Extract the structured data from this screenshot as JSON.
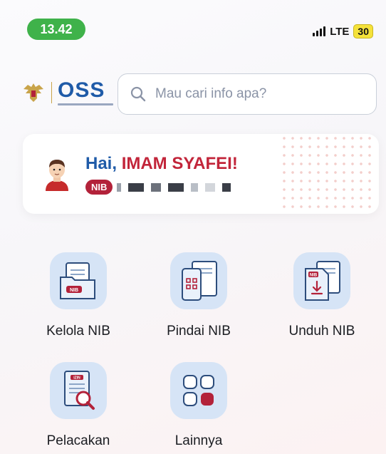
{
  "status_bar": {
    "time": "13.42",
    "network": "LTE",
    "battery": "30"
  },
  "header": {
    "logo_text": "OSS",
    "search_placeholder": "Mau cari info apa?"
  },
  "greeting": {
    "hai": "Hai, ",
    "name": "IMAM SYAFEI!",
    "nib_badge": "NIB"
  },
  "menu": {
    "items": [
      {
        "label": "Kelola NIB",
        "icon": "folder-nib-icon"
      },
      {
        "label": "Pindai NIB",
        "icon": "scan-nib-icon"
      },
      {
        "label": "Unduh NIB",
        "icon": "download-nib-icon"
      },
      {
        "label": "Pelacakan",
        "icon": "tracking-icon"
      },
      {
        "label": "Lainnya",
        "icon": "more-grid-icon"
      }
    ],
    "icon_badges": {
      "kelola": "NIB",
      "unduh": "NIB",
      "pelacakan": "IZIN"
    }
  },
  "colors": {
    "brand_blue": "#1f5ba8",
    "brand_red": "#c2253a",
    "time_green": "#3fb24a",
    "icon_bg": "#d6e4f6"
  }
}
